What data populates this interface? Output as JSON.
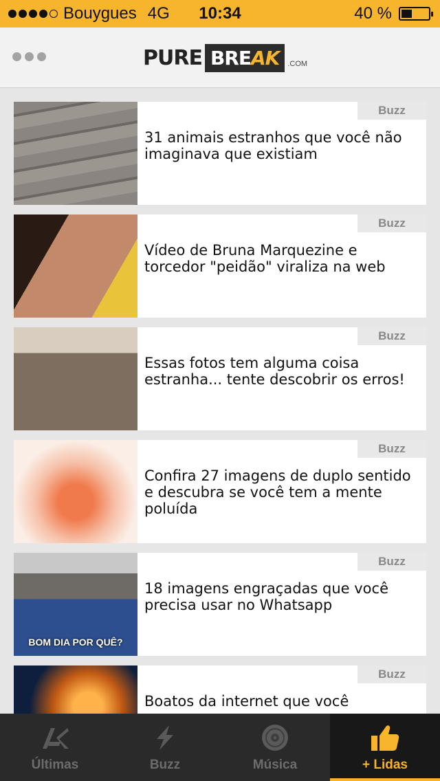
{
  "status": {
    "carrier": "Bouygues",
    "network": "4G",
    "time": "10:34",
    "battery_percent": "40 %",
    "battery_level": 0.4,
    "signal_bars": 4
  },
  "header": {
    "logo_pure": "PURE",
    "logo_bre": "BRE",
    "logo_ak": "AK",
    "logo_com": ".COM"
  },
  "articles": [
    {
      "tag": "Buzz",
      "title": "31 animais estranhos que você não imaginava que existiam"
    },
    {
      "tag": "Buzz",
      "title": "Vídeo de Bruna Marquezine e torcedor \"peidão\" viraliza na web"
    },
    {
      "tag": "Buzz",
      "title": "Essas fotos tem alguma coisa estranha... tente descobrir os erros!"
    },
    {
      "tag": "Buzz",
      "title": "Confira 27 imagens de duplo sentido e descubra se você tem a mente poluída"
    },
    {
      "tag": "Buzz",
      "title": "18 imagens engraçadas que você precisa usar no Whatsapp",
      "image_caption": "BOM DIA POR QUÊ?"
    },
    {
      "tag": "Buzz",
      "title": "Boatos da internet que você"
    }
  ],
  "tabs": [
    {
      "label": "Últimas",
      "icon": "ak-logo-icon"
    },
    {
      "label": "Buzz",
      "icon": "lightning-icon"
    },
    {
      "label": "Música",
      "icon": "vinyl-record-icon"
    },
    {
      "label": "+ Lidas",
      "icon": "thumbs-up-icon",
      "active": true
    }
  ],
  "colors": {
    "accent": "#f7b52e",
    "tabbar_bg": "#2a2a2a",
    "tag_bg": "#e8e8e8"
  }
}
